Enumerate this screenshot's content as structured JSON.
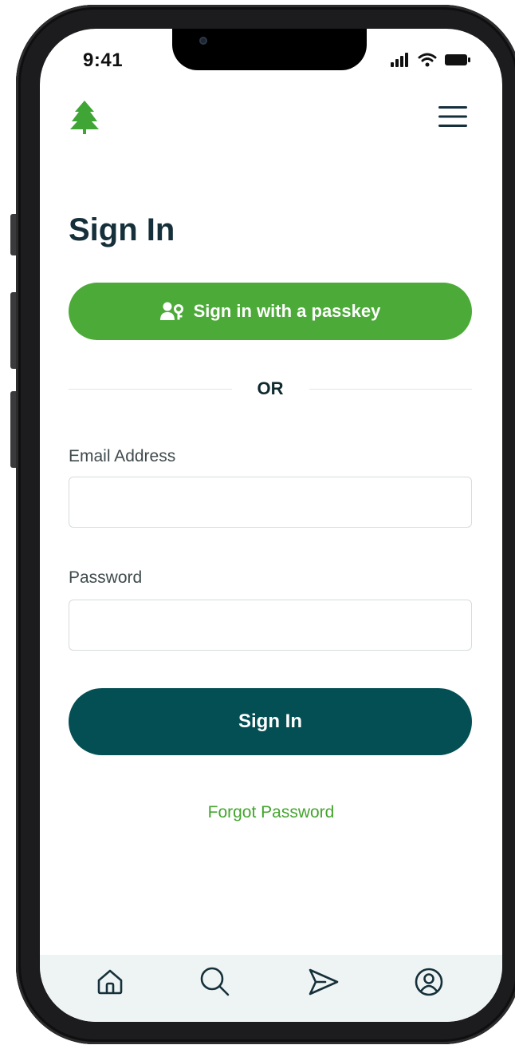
{
  "status_bar": {
    "time": "9:41"
  },
  "header": {
    "logo_icon": "tree-icon",
    "menu_icon": "hamburger-menu-icon"
  },
  "page": {
    "title": "Sign In"
  },
  "passkey_button": {
    "label": "Sign in with a passkey",
    "icon": "user-key-icon"
  },
  "divider": {
    "text": "OR"
  },
  "form": {
    "email": {
      "label": "Email Address",
      "value": "",
      "placeholder": ""
    },
    "password": {
      "label": "Password",
      "value": "",
      "placeholder": ""
    },
    "submit_label": "Sign In",
    "forgot_label": "Forgot Password"
  },
  "tab_bar": {
    "items": [
      {
        "icon": "home-icon"
      },
      {
        "icon": "search-icon"
      },
      {
        "icon": "send-icon"
      },
      {
        "icon": "profile-icon"
      }
    ]
  },
  "colors": {
    "brand_green": "#4caa38",
    "primary_teal": "#034f54",
    "title_text": "#15303a",
    "link_green": "#43a52d",
    "tab_bar_bg": "#eef4f4"
  }
}
